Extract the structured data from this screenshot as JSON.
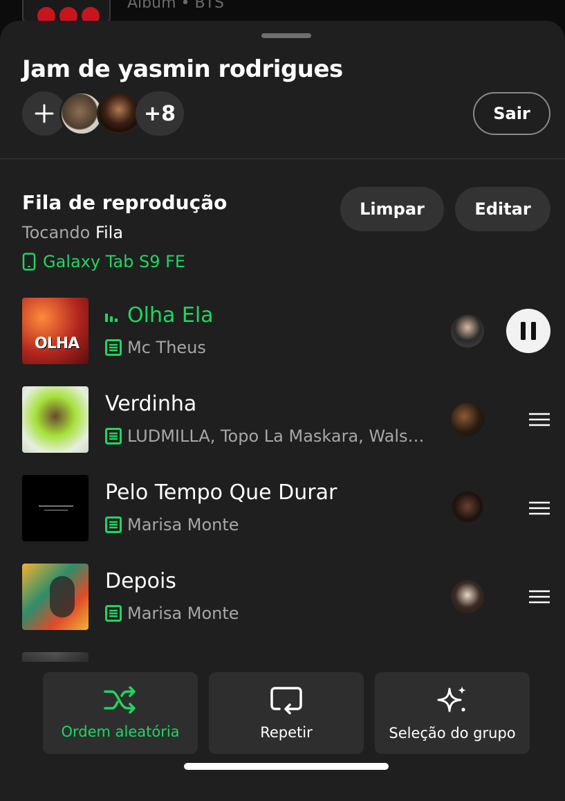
{
  "background": {
    "subtitle": "Album • BTS"
  },
  "jam": {
    "title": "Jam de yasmin rodrigues",
    "add_label": "Adicionar participante",
    "more_participants": "+8",
    "leave_label": "Sair"
  },
  "queue": {
    "title": "Fila de reprodução",
    "playing_prefix": "Tocando",
    "playing_source": "Fila",
    "device": "Galaxy Tab S9 FE",
    "clear_label": "Limpar",
    "edit_label": "Editar",
    "tracks": [
      {
        "title": "Olha Ela",
        "artist": "Mc Theus",
        "now_playing": true
      },
      {
        "title": "Verdinha",
        "artist": "LUDMILLA, Topo La Maskara, Walsh...",
        "now_playing": false
      },
      {
        "title": "Pelo Tempo Que Durar",
        "artist": "Marisa Monte",
        "now_playing": false
      },
      {
        "title": "Depois",
        "artist": "Marisa Monte",
        "now_playing": false
      }
    ]
  },
  "actions": {
    "shuffle_label": "Ordem aleatória",
    "repeat_label": "Repetir",
    "group_label": "Seleção do grupo"
  },
  "colors": {
    "accent": "#1ed760",
    "sheet": "#1f1f1f",
    "button": "#333333",
    "secondary_text": "#a7a7a7"
  }
}
